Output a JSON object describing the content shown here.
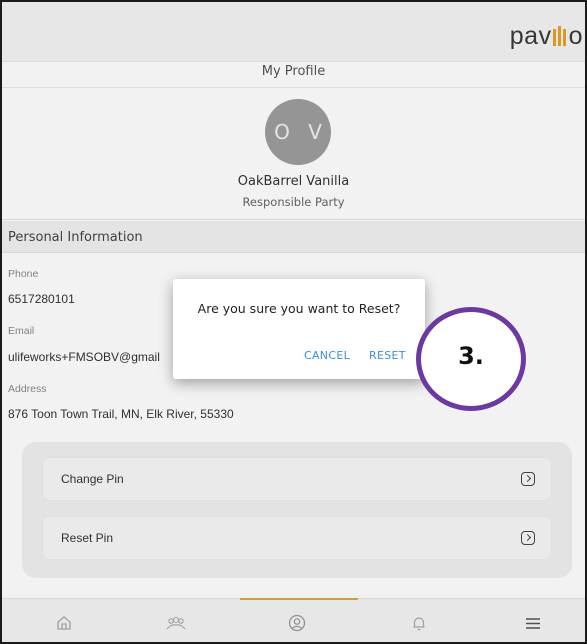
{
  "header": {
    "logo_text_start": "pav",
    "logo_text_end": "o"
  },
  "profile": {
    "title": "My Profile",
    "initials": "O V",
    "name": "OakBarrel Vanilla",
    "role": "Responsible Party"
  },
  "personal_info": {
    "heading": "Personal Information",
    "phone_label": "Phone",
    "phone_value": "6517280101",
    "email_label": "Email",
    "email_value": "ulifeworks+FMSOBV@gmail",
    "address_label": "Address",
    "address_value": "876 Toon Town Trail, MN, Elk River, 55330"
  },
  "pin_actions": [
    {
      "label": "Change Pin"
    },
    {
      "label": "Reset Pin"
    }
  ],
  "dialog": {
    "question": "Are you sure you want to Reset?",
    "cancel_label": "CANCEL",
    "reset_label": "RESET"
  },
  "callout": {
    "label": "3."
  },
  "bottom_nav": [
    "home-icon",
    "family-icon",
    "profile-icon",
    "bell-icon",
    "menu-icon"
  ],
  "colors": {
    "accent": "#e6a22a",
    "link": "#3e8fd6",
    "callout_border": "#6b3aa0"
  }
}
